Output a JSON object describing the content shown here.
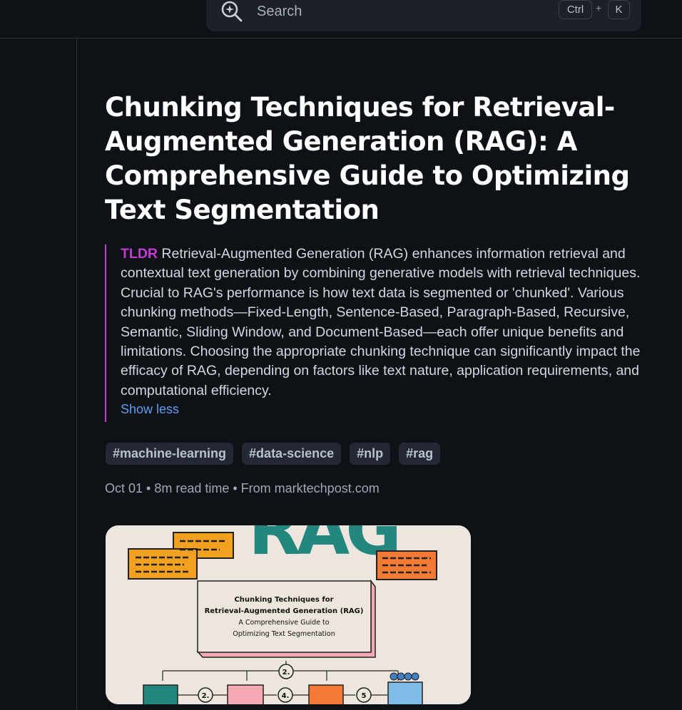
{
  "search": {
    "placeholder": "Search",
    "shortcut_ctrl": "Ctrl",
    "shortcut_plus": "+",
    "shortcut_key": "K"
  },
  "article": {
    "title": "Chunking Techniques for Retrieval-Augmented Generation (RAG): A Comprehensive Guide to Optimizing Text Segmentation",
    "tldr_label": "TLDR",
    "tldr_text": " Retrieval-Augmented Generation (RAG) enhances information retrieval and contextual text generation by combining generative models with retrieval techniques. Crucial to RAG's performance is how text data is segmented or 'chunked'. Various chunking methods—Fixed-Length, Sentence-Based, Paragraph-Based, Recursive, Semantic, Sliding Window, and Document-Based—each offer unique benefits and limitations. Choosing the appropriate chunking technique can significantly impact the efficacy of RAG, depending on factors like text nature, application requirements, and computational efficiency.",
    "show_less": "Show less",
    "tags": [
      "#machine-learning",
      "#data-science",
      "#nlp",
      "#rag"
    ],
    "meta": "Oct 01 • 8m read time • From marktechpost.com"
  },
  "cover_image": {
    "logo_text": "RAG",
    "box_line1": "Chunking Techniques for",
    "box_line2": "Retrieval-Augmented Generation (RAG)",
    "box_line3": "A Comprehensive Guide to",
    "box_line4": "Optimizing Text Segmentation",
    "step_2": "2.",
    "step_2b": "2.",
    "step_4": "4.",
    "step_5": "5",
    "colors": {
      "orange": "#f2a020",
      "teal": "#23877f",
      "coral": "#f27a34",
      "pink": "#f4a9b5",
      "blue": "#3f7fc2"
    }
  }
}
